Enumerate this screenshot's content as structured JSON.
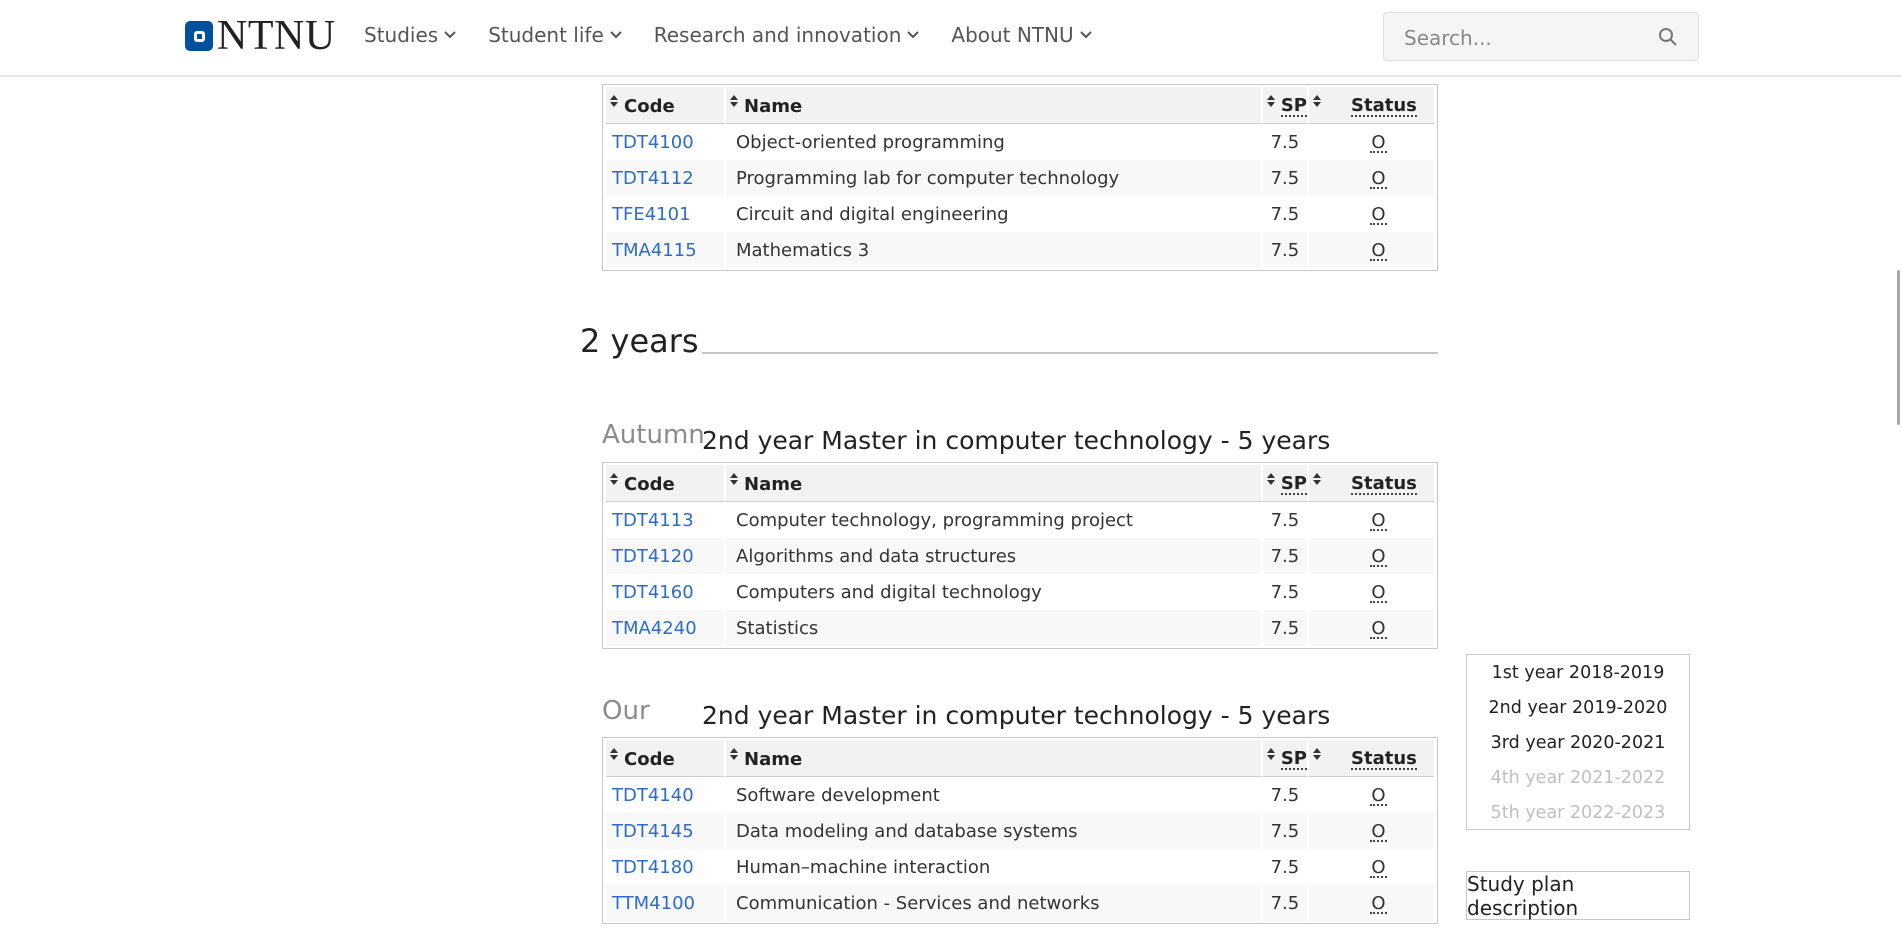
{
  "header": {
    "logo_text": "NTNU",
    "nav": [
      {
        "label": "Studies"
      },
      {
        "label": "Student life"
      },
      {
        "label": "Research and innovation"
      },
      {
        "label": "About NTNU"
      }
    ],
    "search_placeholder": "Search..."
  },
  "table_headers": {
    "code": "Code",
    "name": "Name",
    "sp": "SP",
    "status": "Status"
  },
  "top_table": {
    "rows": [
      {
        "code": "TDT4100",
        "name": "Object-oriented programming",
        "sp": "7.5",
        "status": "O"
      },
      {
        "code": "TDT4112",
        "name": "Programming lab for computer technology",
        "sp": "7.5",
        "status": "O"
      },
      {
        "code": "TFE4101",
        "name": "Circuit and digital engineering",
        "sp": "7.5",
        "status": "O"
      },
      {
        "code": "TMA4115",
        "name": "Mathematics 3",
        "sp": "7.5",
        "status": "O"
      }
    ]
  },
  "section": {
    "title": "2 years"
  },
  "autumn": {
    "semester": "Autumn",
    "title": "2nd year Master in computer technology - 5 years",
    "rows": [
      {
        "code": "TDT4113",
        "name": "Computer technology, programming project",
        "sp": "7.5",
        "status": "O"
      },
      {
        "code": "TDT4120",
        "name": "Algorithms and data structures",
        "sp": "7.5",
        "status": "O"
      },
      {
        "code": "TDT4160",
        "name": "Computers and digital technology",
        "sp": "7.5",
        "status": "O"
      },
      {
        "code": "TMA4240",
        "name": "Statistics",
        "sp": "7.5",
        "status": "O"
      }
    ]
  },
  "spring": {
    "semester": "Our",
    "title": "2nd year Master in computer technology - 5 years",
    "rows": [
      {
        "code": "TDT4140",
        "name": "Software development",
        "sp": "7.5",
        "status": "O"
      },
      {
        "code": "TDT4145",
        "name": "Data modeling and database systems",
        "sp": "7.5",
        "status": "O"
      },
      {
        "code": "TDT4180",
        "name": "Human–machine interaction",
        "sp": "7.5",
        "status": "O"
      },
      {
        "code": "TTM4100",
        "name": "Communication - Services and networks",
        "sp": "7.5",
        "status": "O"
      }
    ]
  },
  "year_nav": [
    {
      "label": "1st year 2018-2019",
      "enabled": true
    },
    {
      "label": "2nd year 2019-2020",
      "enabled": true
    },
    {
      "label": "3rd year 2020-2021",
      "enabled": true
    },
    {
      "label": "4th year 2021-2022",
      "enabled": false
    },
    {
      "label": "5th year 2022-2023",
      "enabled": false
    }
  ],
  "study_plan_button": "Study plan description",
  "colors": {
    "link": "#2d6bcf",
    "brand": "#00509e",
    "muted": "#8c8c8c"
  },
  "icons": [
    "ntnu-logo-icon",
    "chevron-down-icon",
    "search-icon",
    "sort-icon"
  ]
}
